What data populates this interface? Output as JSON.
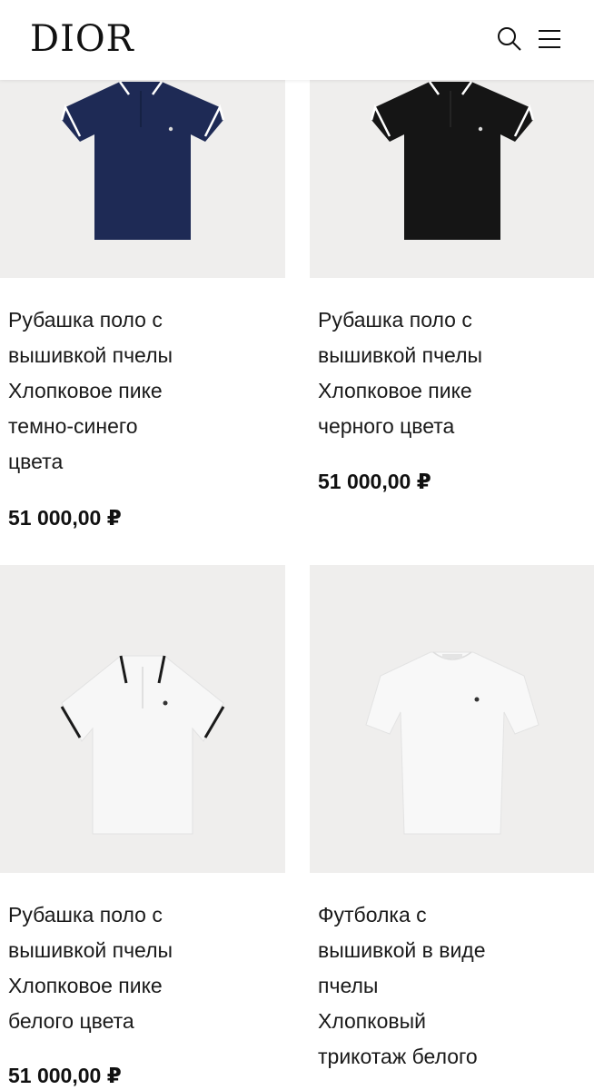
{
  "header": {
    "logo": "DIOR",
    "search_icon": "search-icon",
    "menu_icon": "hamburger-menu-icon"
  },
  "products": [
    {
      "name_lines": [
        "Рубашка поло с",
        "вышивкой пчелы",
        "Хлопковое пике",
        "темно-синего",
        "цвета"
      ],
      "price": "51 000,00 ₽",
      "color": "#1e2a55",
      "image": "navy-polo-shirt-image"
    },
    {
      "name_lines": [
        "Рубашка поло с",
        "вышивкой пчелы",
        "Хлопковое пике",
        "черного цвета"
      ],
      "price": "51 000,00 ₽",
      "color": "#151515",
      "image": "black-polo-shirt-image"
    },
    {
      "name_lines": [
        "Рубашка поло с",
        "вышивкой пчелы",
        "Хлопковое пике",
        "белого цвета"
      ],
      "price": "51 000,00 ₽",
      "color": "#f7f7f7",
      "image": "white-polo-shirt-image"
    },
    {
      "name_lines": [
        "Футболка с",
        "вышивкой в виде",
        "пчелы",
        "Хлопковый",
        "трикотаж белого"
      ],
      "color": "#f8f8f8",
      "image": "white-t-shirt-image"
    }
  ]
}
